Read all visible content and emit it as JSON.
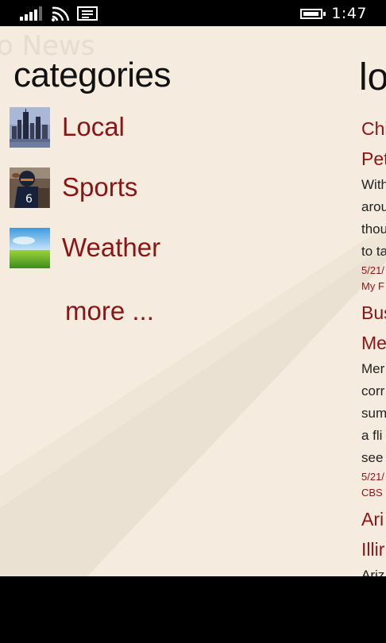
{
  "status_bar": {
    "time": "1:47",
    "icons": [
      "signal-icon",
      "wifi-icon",
      "message-icon",
      "battery-icon"
    ]
  },
  "app": {
    "title": "o News"
  },
  "categories": {
    "title": "categories",
    "items": [
      {
        "label": "Local",
        "icon": "city-skyline-thumbnail"
      },
      {
        "label": "Sports",
        "icon": "football-player-thumbnail"
      },
      {
        "label": "Weather",
        "icon": "sky-grass-thumbnail"
      }
    ],
    "more_label": "more ..."
  },
  "local": {
    "title": "lo",
    "articles": [
      {
        "title_lines": [
          "Chi",
          "Pet"
        ],
        "body_lines": [
          "With",
          "arou",
          "thou",
          "to ta"
        ],
        "meta_lines": [
          "5/21/",
          "My F"
        ]
      },
      {
        "title_lines": [
          "Bus",
          "Me"
        ],
        "body_lines": [
          "Mer",
          "corr",
          "sum",
          "a fli",
          "see"
        ],
        "meta_lines": [
          "5/21/",
          "CBS"
        ]
      },
      {
        "title_lines": [
          "Ari",
          "Illir"
        ],
        "body_lines": [
          "Ariz"
        ],
        "meta_lines": []
      }
    ]
  },
  "colors": {
    "background": "#f5ecdf",
    "accent": "#8b1414",
    "text": "#111111"
  }
}
